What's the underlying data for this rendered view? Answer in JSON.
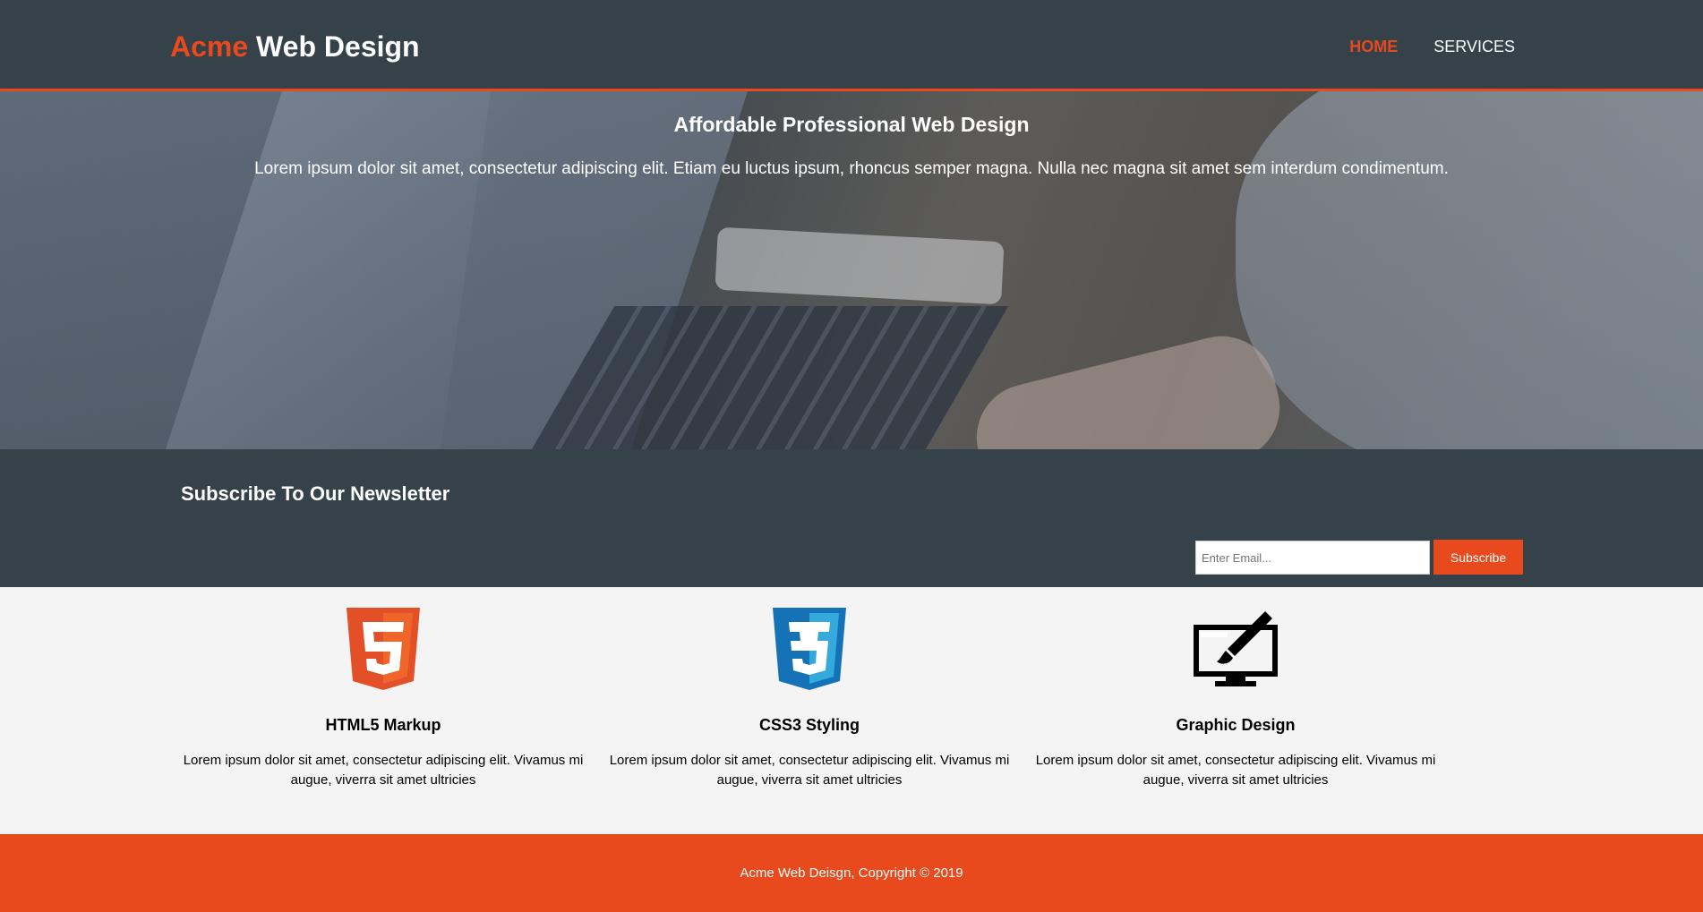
{
  "header": {
    "brand_highlight": "Acme",
    "brand_rest": "Web Design",
    "nav": [
      {
        "label": "HOME",
        "active": true
      },
      {
        "label": "SERVICES",
        "active": false
      }
    ]
  },
  "showcase": {
    "title": "Affordable Professional Web Design",
    "text": "Lorem ipsum dolor sit amet, consectetur adipiscing elit. Etiam eu luctus ipsum, rhoncus semper magna. Nulla nec magna sit amet sem interdum condimentum."
  },
  "newsletter": {
    "title": "Subscribe To Our Newsletter",
    "email_placeholder": "Enter Email...",
    "subscribe_label": "Subscribe"
  },
  "boxes": [
    {
      "icon": "html5-logo-icon",
      "title": "HTML5 Markup",
      "text": "Lorem ipsum dolor sit amet, consectetur adipiscing elit. Vivamus mi augue, viverra sit amet ultricies"
    },
    {
      "icon": "css3-logo-icon",
      "title": "CSS3 Styling",
      "text": "Lorem ipsum dolor sit amet, consectetur adipiscing elit. Vivamus mi augue, viverra sit amet ultricies"
    },
    {
      "icon": "monitor-brush-icon",
      "title": "Graphic Design",
      "text": "Lorem ipsum dolor sit amet, consectetur adipiscing elit. Vivamus mi augue, viverra sit amet ultricies"
    }
  ],
  "footer": {
    "text": "Acme Web Deisgn, Copyright © 2019"
  },
  "colors": {
    "accent": "#e8491d",
    "dark": "#35424a",
    "light_bg": "#f4f4f4",
    "html5_orange": "#e34f26",
    "css3_blue": "#1572b6"
  }
}
